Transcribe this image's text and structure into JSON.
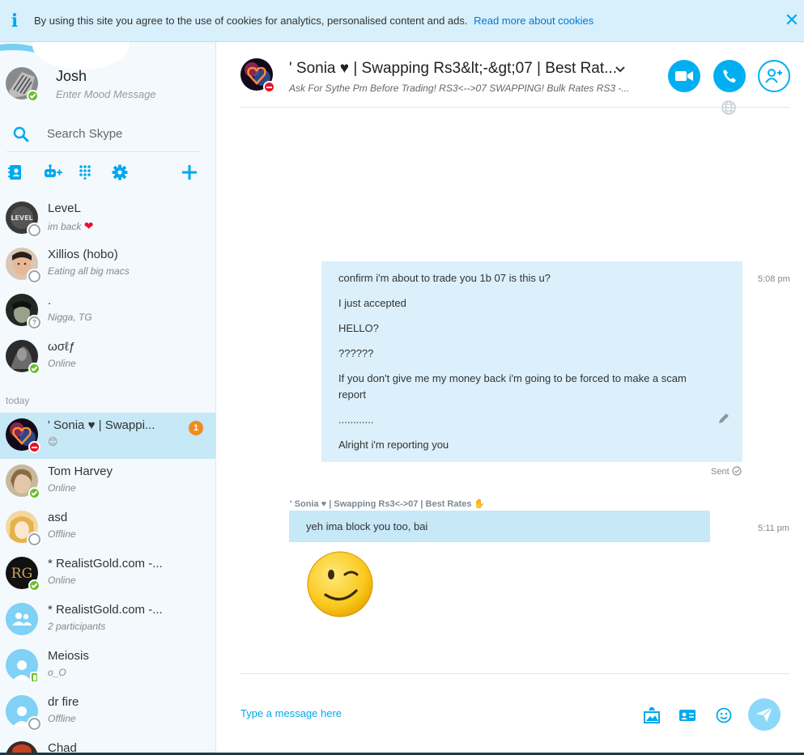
{
  "cookie_bar": {
    "text": "By using this site you agree to the use of cookies for analytics, personalised content and ads.",
    "link": "Read more about cookies",
    "icon": "info-icon",
    "close_icon": "close-icon"
  },
  "profile": {
    "name": "Josh",
    "mood_placeholder": "Enter Mood Message",
    "status": "online"
  },
  "search": {
    "placeholder": "Search Skype"
  },
  "toolbar": {
    "icons": [
      "contacts-book-icon",
      "add-bot-icon",
      "dialpad-icon",
      "settings-gear-icon",
      "plus-icon"
    ]
  },
  "contacts": [
    {
      "name": "LeveL",
      "sub": "im back",
      "status": "offline",
      "emoji": "heart"
    },
    {
      "name": "Xillios (hobo)",
      "sub": "Eating all big macs",
      "status": "offline"
    },
    {
      "name": ".",
      "sub": "Nigga, TG",
      "status": "unknown"
    },
    {
      "name": "ωσℓƒ",
      "sub": "Online",
      "status": "online"
    }
  ],
  "today_label": "today",
  "recent": [
    {
      "name": "' Sonia ♥ | Swappi...",
      "sub": "😊",
      "status": "dnd",
      "unread": "1",
      "selected": true
    },
    {
      "name": "Tom Harvey",
      "sub": "Online",
      "status": "online"
    },
    {
      "name": "asd",
      "sub": "Offline",
      "status": "offline"
    },
    {
      "name": "* RealistGold.com -...",
      "sub": "Online",
      "status": "online"
    },
    {
      "name": "* RealistGold.com -...",
      "sub": "2 participants",
      "status": "group"
    },
    {
      "name": "Meiosis",
      "sub": "o_O",
      "status": "mobile"
    },
    {
      "name": "dr fire",
      "sub": "Offline",
      "status": "offline"
    },
    {
      "name": "Chad",
      "sub": "",
      "status": "offline"
    }
  ],
  "chat": {
    "title": "' Sonia ♥ | Swapping Rs3&lt;-&gt;07 | Best Rat...",
    "mood": "Ask For Sythe Pm Before Trading! RS3<-->07 SWAPPING! Bulk Rates RS3 -...",
    "buttons": [
      "video-call-button",
      "audio-call-button",
      "add-participant-button"
    ],
    "outgoing": {
      "time": "5:08 pm",
      "lines": [
        "confirm i'm about to trade you 1b 07 is this u?",
        "I just accepted",
        "HELLO?",
        "??????",
        "If you don't give me my money back i'm going to be forced to make a scam report",
        "............",
        "Alright i'm reporting you"
      ],
      "status": "Sent"
    },
    "incoming": {
      "sender": "' Sonia ♥ | Swapping Rs3<->07 | Best Rates ✋",
      "time": "5:11 pm",
      "text": "yeh ima block you too, bai",
      "emoticon": "wink-emoticon"
    },
    "compose_placeholder": "Type a message here"
  }
}
